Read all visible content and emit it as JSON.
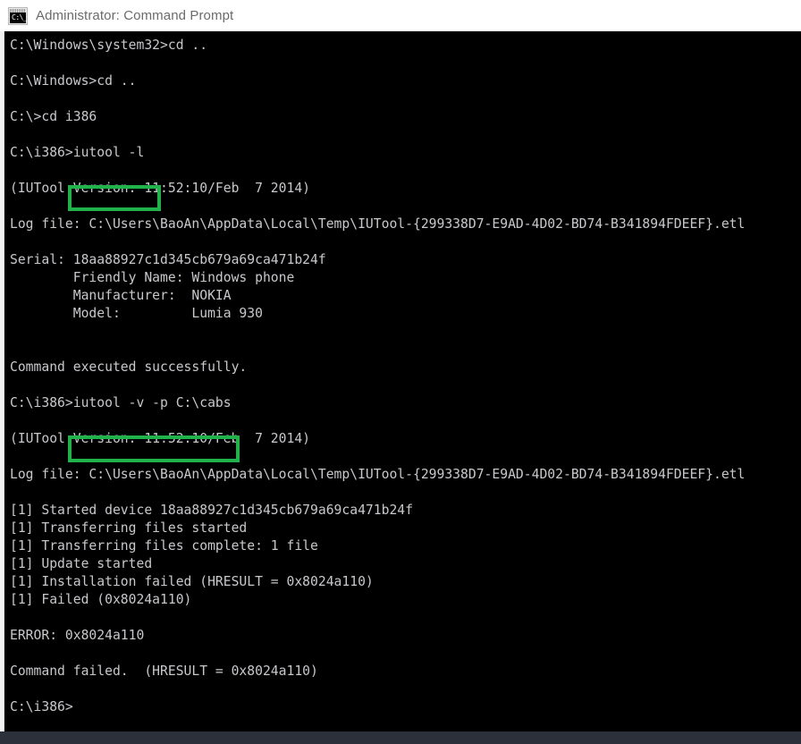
{
  "window": {
    "title": "Administrator: Command Prompt",
    "icon": "command-prompt-icon",
    "icon_glyph": "C:\\_",
    "colors": {
      "titlebar_background": "#ffffff",
      "titlebar_text": "#6b6b6b",
      "console_background": "#000000",
      "console_text": "#c8c8cc",
      "highlight_green": "#22b24c",
      "bottom_bar": "#2b303a",
      "left_frame": "#f2f2f2"
    }
  },
  "console": {
    "lines": [
      "C:\\Windows\\system32>cd ..",
      "",
      "C:\\Windows>cd ..",
      "",
      "C:\\>cd i386",
      "",
      "C:\\i386>iutool -l",
      "",
      "(IUTool Version: 11:52:10/Feb  7 2014)",
      "",
      "Log file: C:\\Users\\BaoAn\\AppData\\Local\\Temp\\IUTool-{299338D7-E9AD-4D02-BD74-B341894FDEEF}.etl",
      "",
      "Serial: 18aa88927c1d345cb679a69ca471b24f",
      "        Friendly Name: Windows phone",
      "        Manufacturer:  NOKIA",
      "        Model:         Lumia 930",
      "",
      "",
      "Command executed successfully.",
      "",
      "C:\\i386>iutool -v -p C:\\cabs",
      "",
      "(IUTool Version: 11:52:10/Feb  7 2014)",
      "",
      "Log file: C:\\Users\\BaoAn\\AppData\\Local\\Temp\\IUTool-{299338D7-E9AD-4D02-BD74-B341894FDEEF}.etl",
      "",
      "[1] Started device 18aa88927c1d345cb679a69ca471b24f",
      "[1] Transferring files started",
      "[1] Transferring files complete: 1 file",
      "[1] Update started",
      "[1] Installation failed (HRESULT = 0x8024a110)",
      "[1] Failed (0x8024a110)",
      "",
      "ERROR: 0x8024a110",
      "",
      "Command failed.  (HRESULT = 0x8024a110)",
      "",
      "C:\\i386>"
    ],
    "highlights": [
      {
        "name": "iutool-list-command",
        "text": "iutool -l",
        "color": "#22b24c"
      },
      {
        "name": "iutool-flash-command",
        "text": "iutool -v -p C:\\cabs",
        "color": "#22b24c"
      }
    ],
    "details": {
      "serial": "18aa88927c1d345cb679a69ca471b24f",
      "friendly_name": "Windows phone",
      "manufacturer": "NOKIA",
      "model": "Lumia 930",
      "iutool_version": "11:52:10/Feb  7 2014",
      "log_file": "C:\\Users\\BaoAn\\AppData\\Local\\Temp\\IUTool-{299338D7-E9AD-4D02-BD74-B341894FDEEF}.etl",
      "error_code": "0x8024a110",
      "files_transferred": "1 file",
      "prompt": "C:\\i386>"
    }
  }
}
